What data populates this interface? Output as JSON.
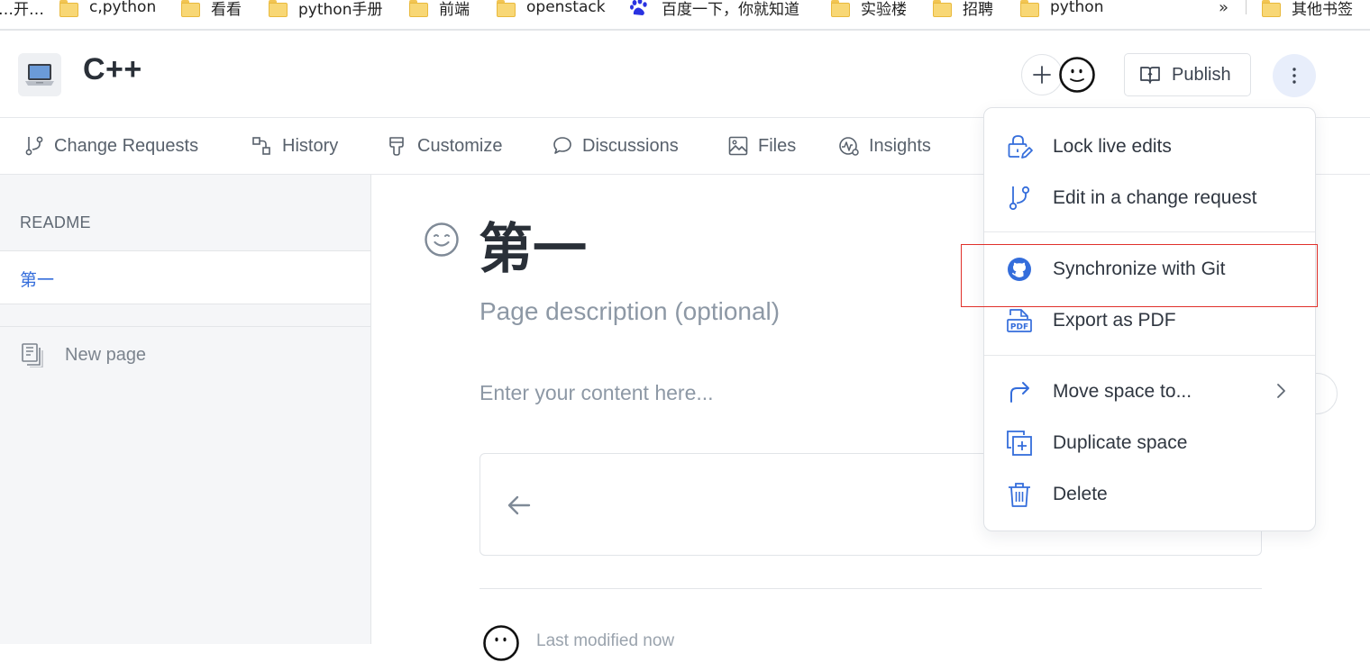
{
  "bookmarks": {
    "items": [
      {
        "label": "…开…",
        "icon": "folder-icon"
      },
      {
        "label": "c,python",
        "icon": "folder-icon"
      },
      {
        "label": "看看",
        "icon": "folder-icon"
      },
      {
        "label": "python手册",
        "icon": "folder-icon"
      },
      {
        "label": "前端",
        "icon": "folder-icon"
      },
      {
        "label": "openstack",
        "icon": "folder-icon"
      },
      {
        "label": "百度一下，你就知道",
        "icon": "baidu-paw-icon"
      },
      {
        "label": "实验楼",
        "icon": "folder-icon"
      },
      {
        "label": "招聘",
        "icon": "folder-icon"
      },
      {
        "label": "python",
        "icon": "folder-icon"
      },
      {
        "label": "其他书签",
        "icon": "folder-icon"
      }
    ],
    "overflow": "»"
  },
  "header": {
    "space_icon": "laptop-emoji-icon",
    "title": "C++",
    "add_icon": "plus-icon",
    "avatar": "avatar-icon",
    "publish_label": "Publish",
    "more_icon": "vertical-dots-icon"
  },
  "tabs": [
    {
      "label": "Change Requests",
      "icon": "branch-icon"
    },
    {
      "label": "History",
      "icon": "history-icon"
    },
    {
      "label": "Customize",
      "icon": "paint-brush-icon"
    },
    {
      "label": "Discussions",
      "icon": "speech-bubble-icon"
    },
    {
      "label": "Files",
      "icon": "image-icon"
    },
    {
      "label": "Insights",
      "icon": "insights-icon"
    }
  ],
  "sidebar": {
    "group_title": "README",
    "active_page": "第一",
    "new_page_label": "New page",
    "colors": {
      "active": "#346ddb"
    }
  },
  "content": {
    "title": "第一",
    "description_placeholder": "Page description (optional)",
    "body_placeholder": "Enter your content here...",
    "last_modified": "Last modified now"
  },
  "menu": {
    "items": [
      {
        "label": "Lock live edits",
        "icon": "lock-edit-icon"
      },
      {
        "label": "Edit in a change request",
        "icon": "branch-icon"
      },
      {
        "label": "Synchronize with Git",
        "icon": "github-icon",
        "highlighted": true
      },
      {
        "label": "Export as PDF",
        "icon": "pdf-icon"
      },
      {
        "label": "Move space to...",
        "icon": "forward-arrow-icon",
        "has_submenu": true
      },
      {
        "label": "Duplicate space",
        "icon": "duplicate-icon"
      },
      {
        "label": "Delete",
        "icon": "trash-icon"
      }
    ],
    "accent_color": "#346ddb",
    "highlight_color": "#e0312b"
  }
}
